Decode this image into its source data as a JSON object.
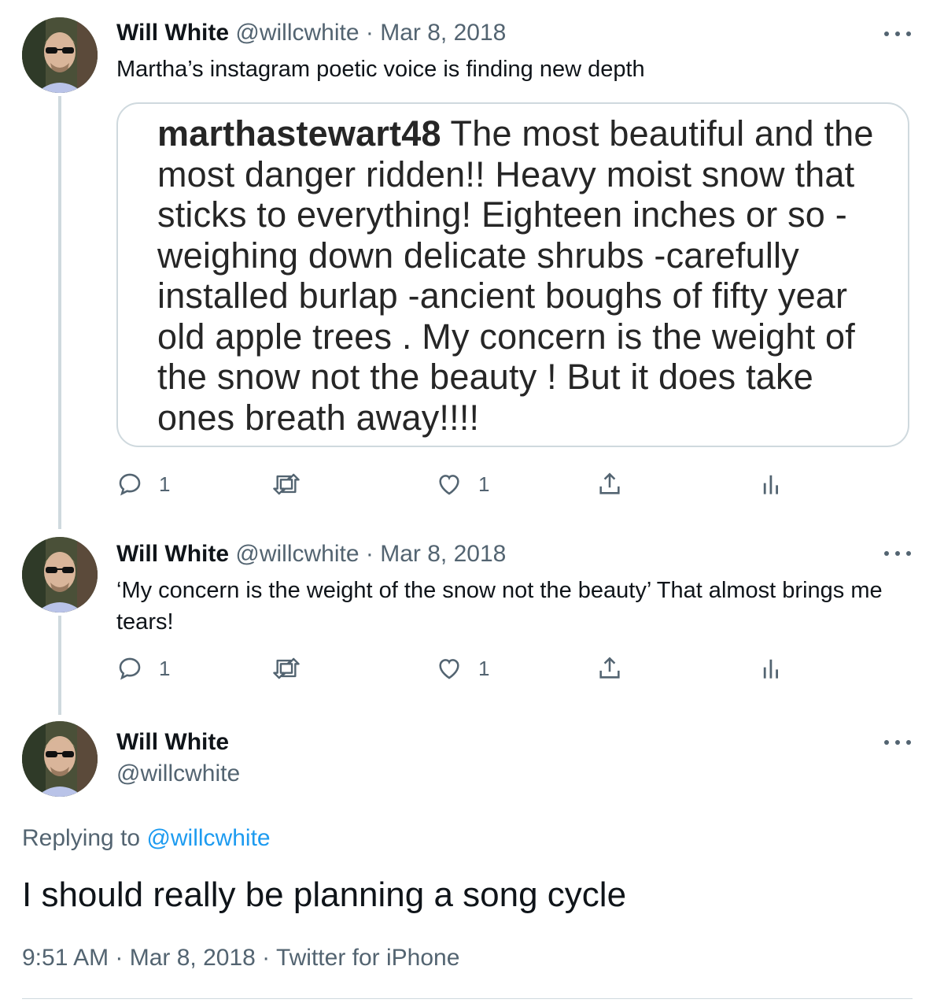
{
  "tweets": [
    {
      "name": "Will White",
      "handle": "@willcwhite",
      "sep": "·",
      "date": "Mar 8, 2018",
      "text": "Martha’s instagram poetic voice is finding new depth",
      "quote": {
        "author": "marthastewart48",
        "text": " The most beautiful and the most danger ridden!! Heavy moist snow that sticks to everything! Eighteen inches or so -weighing down delicate shrubs -carefully installed burlap -ancient boughs of fifty year old apple trees .  My concern is the weight of the snow  not the beauty !  But it does take ones breath away!!!!"
      },
      "replies": "1",
      "likes": "1"
    },
    {
      "name": "Will White",
      "handle": "@willcwhite",
      "sep": "·",
      "date": "Mar 8, 2018",
      "text": "‘My concern is the weight of the snow not the beauty’ That almost brings me tears!",
      "replies": "1",
      "likes": "1"
    }
  ],
  "main_tweet": {
    "name": "Will White",
    "handle": "@willcwhite",
    "replying_prefix": "Replying to ",
    "replying_handle": "@willcwhite",
    "text": "I should really be planning a song cycle",
    "time": "9:51 AM",
    "sep1": " · ",
    "date": "Mar 8, 2018",
    "sep2": " · ",
    "source": "Twitter for iPhone"
  },
  "icons": {
    "reply": "reply-icon",
    "retweet": "retweet-icon",
    "like": "heart-icon",
    "share": "share-icon",
    "analytics": "analytics-icon",
    "more": "more-icon"
  },
  "colors": {
    "text": "#0f1419",
    "secondary": "#536471",
    "link": "#1d9bf0",
    "border": "#cfd9de"
  }
}
